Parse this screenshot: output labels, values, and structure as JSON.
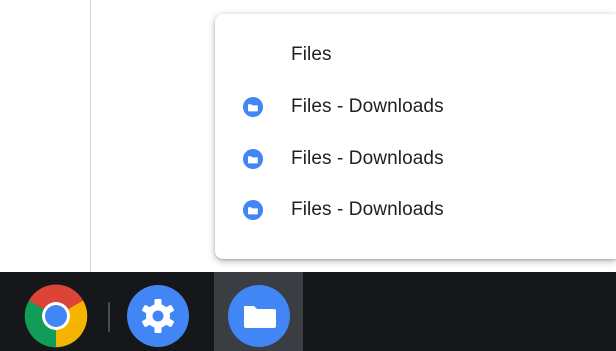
{
  "menu": {
    "items": [
      {
        "label": "Files",
        "icon": "none"
      },
      {
        "label": "Files - Downloads",
        "icon": "files-app-icon"
      },
      {
        "label": "Files - Downloads",
        "icon": "files-app-icon"
      },
      {
        "label": "Files - Downloads",
        "icon": "files-app-icon"
      }
    ]
  },
  "shelf": {
    "apps": [
      {
        "name": "chrome",
        "icon": "chrome-icon"
      },
      {
        "name": "settings",
        "icon": "settings-gear-icon"
      },
      {
        "name": "files",
        "icon": "folder-icon",
        "active": true
      }
    ]
  },
  "colors": {
    "accent_blue": "#4285f4",
    "menu_text": "#202124",
    "shelf_bg": "#15171a"
  }
}
